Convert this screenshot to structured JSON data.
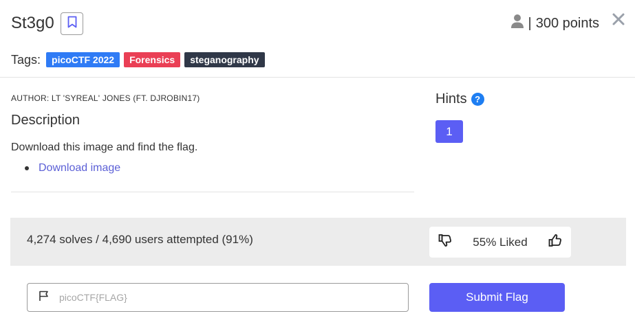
{
  "challenge": {
    "title": "St3g0",
    "points_text": "300 points",
    "separator": "|"
  },
  "icons": {
    "bookmark": "bookmark-icon",
    "user": "user-icon",
    "close": "close-icon",
    "help": "question-circle-icon",
    "flag": "flag-icon",
    "thumbs_down": "thumbs-down-icon",
    "thumbs_up": "thumbs-up-icon"
  },
  "tags": {
    "label": "Tags:",
    "items": [
      {
        "label": "picoCTF 2022",
        "color": "#2f7bf5"
      },
      {
        "label": "Forensics",
        "color": "#ea3f55"
      },
      {
        "label": "steganography",
        "color": "#303848"
      }
    ]
  },
  "description": {
    "author": "AUTHOR: LT 'SYREAL' JONES (FT. DJROBIN17)",
    "heading": "Description",
    "text": "Download this image and find the flag.",
    "link_label": "Download image"
  },
  "hints": {
    "heading": "Hints",
    "help_glyph": "?",
    "button_label": "1"
  },
  "stats": {
    "text": "4,274 solves / 4,690 users attempted (91%)",
    "liked_text": "55% Liked"
  },
  "flag_form": {
    "placeholder": "picoCTF{FLAG}",
    "value": "",
    "submit_label": "Submit Flag"
  },
  "colors": {
    "accent": "#5b5ef4",
    "link": "#5b5fd6",
    "help": "#1e7ef2"
  }
}
